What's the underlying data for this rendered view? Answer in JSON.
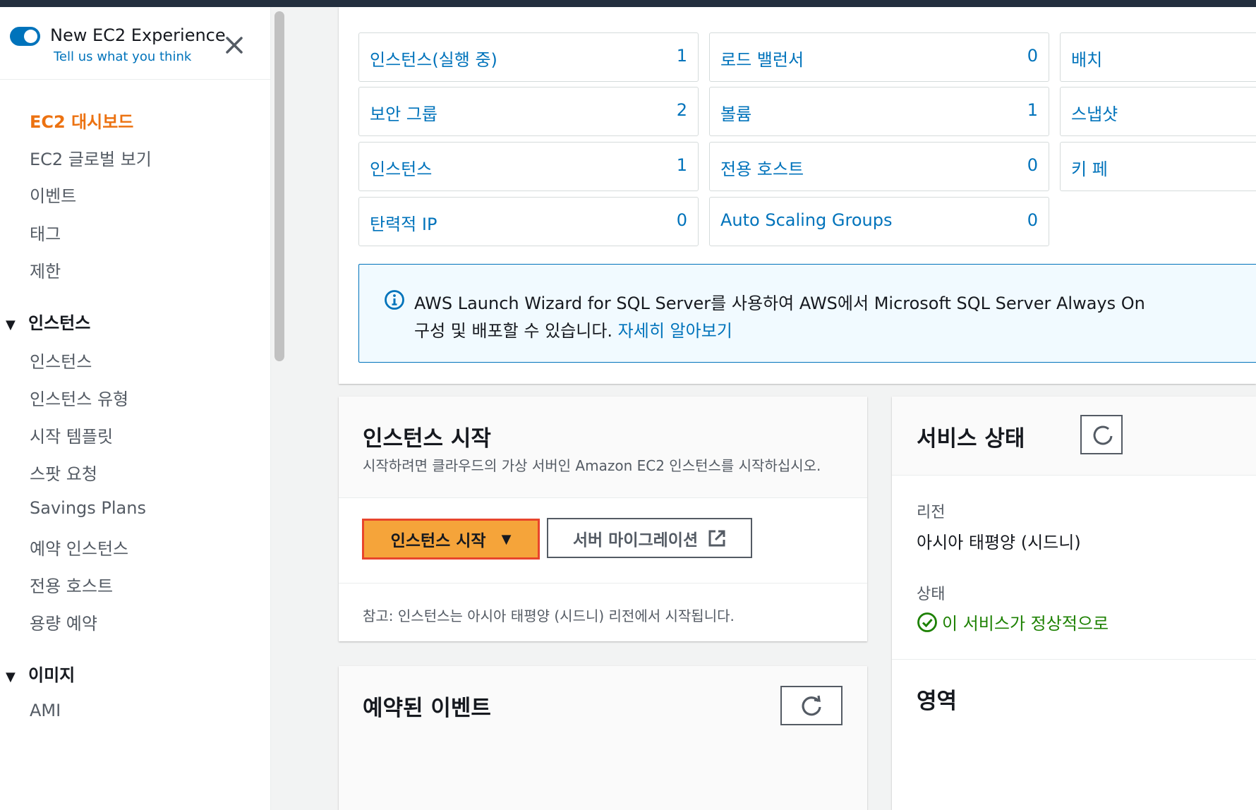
{
  "experience": {
    "title": "New EC2 Experience",
    "feedback_link": "Tell us what you think"
  },
  "sidebar": {
    "items": [
      {
        "label": "EC2 대시보드",
        "active": true
      },
      {
        "label": "EC2 글로벌 보기"
      },
      {
        "label": "이벤트"
      },
      {
        "label": "태그"
      },
      {
        "label": "제한"
      }
    ],
    "sections": [
      {
        "label": "인스턴스",
        "items": [
          "인스턴스",
          "인스턴스 유형",
          "시작 템플릿",
          "스팟 요청",
          "Savings Plans",
          "예약 인스턴스",
          "전용 호스트",
          "용량 예약"
        ]
      },
      {
        "label": "이미지",
        "items": [
          "AMI"
        ]
      }
    ]
  },
  "resources": {
    "tiles": [
      {
        "label": "인스턴스(실행 중)",
        "count": "1"
      },
      {
        "label": "로드 밸런서",
        "count": "0"
      },
      {
        "label": "배치",
        "count": ""
      },
      {
        "label": "보안 그룹",
        "count": "2"
      },
      {
        "label": "볼륨",
        "count": "1"
      },
      {
        "label": "스냅샷",
        "count": ""
      },
      {
        "label": "인스턴스",
        "count": "1"
      },
      {
        "label": "전용 호스트",
        "count": "0"
      },
      {
        "label": "키 페",
        "count": ""
      },
      {
        "label": "탄력적 IP",
        "count": "0"
      },
      {
        "label": "Auto Scaling Groups",
        "count": "0"
      }
    ],
    "info": {
      "line1": "AWS Launch Wizard for SQL Server를 사용하여 AWS에서 Microsoft SQL Server Always On",
      "line2": "구성 및 배포할 수 있습니다.",
      "link": "자세히 알아보기"
    }
  },
  "launch": {
    "title": "인스턴스 시작",
    "description": "시작하려면 클라우드의 가상 서버인 Amazon EC2 인스턴스를 시작하십시오.",
    "launch_button": "인스턴스 시작",
    "migrate_button": "서버 마이그레이션",
    "note": "참고: 인스턴스는 아시아 태평양 (시드니) 리전에서 시작됩니다."
  },
  "health": {
    "title": "서비스 상태",
    "region_label": "리전",
    "region_value": "아시아 태평양 (시드니)",
    "status_label": "상태",
    "status_value": "이 서비스가 정상적으로",
    "zone_title": "영역"
  },
  "events": {
    "title": "예약된 이벤트"
  },
  "colors": {
    "accent_orange": "#ec7211",
    "link_blue": "#0073bb",
    "launch_button": "#f5a43a",
    "highlight_border": "#e8452c",
    "ok_green": "#1d8102"
  }
}
